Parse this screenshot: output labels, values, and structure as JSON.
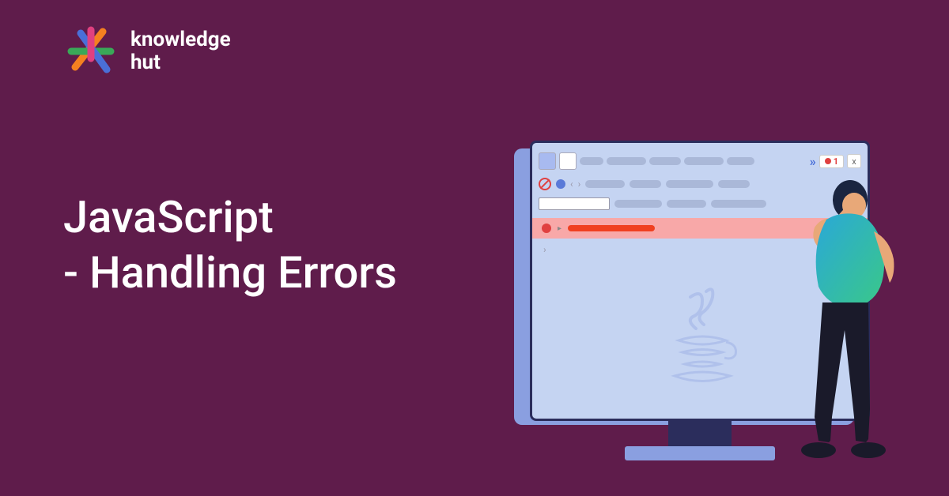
{
  "brand": {
    "name_line1": "knowledge",
    "name_line2": "hut"
  },
  "title": {
    "line1": "JavaScript",
    "line2": "- Handling Errors"
  },
  "devtools": {
    "error_count": "1",
    "close_label": "x",
    "chevron": "»"
  },
  "colors": {
    "background": "#5f1c4b",
    "error": "#e04040",
    "accent": "#4a6fd8"
  }
}
